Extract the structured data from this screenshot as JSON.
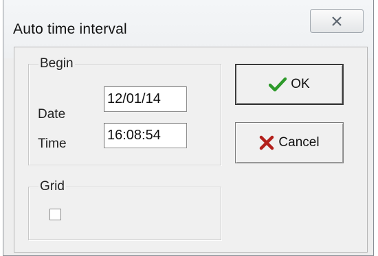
{
  "dialog": {
    "title": "Auto time interval",
    "close_icon": "close-icon"
  },
  "begin": {
    "legend": "Begin",
    "date_label": "Date",
    "date_value": "12/01/14",
    "time_label": "Time",
    "time_value": "16:08:54"
  },
  "grid": {
    "legend": "Grid",
    "checked": false
  },
  "buttons": {
    "ok_label": "OK",
    "ok_icon": "checkmark-icon",
    "cancel_label": "Cancel",
    "cancel_icon": "cross-icon"
  },
  "colors": {
    "ok_icon": "#2e9a2b",
    "cancel_icon": "#b3201b"
  }
}
